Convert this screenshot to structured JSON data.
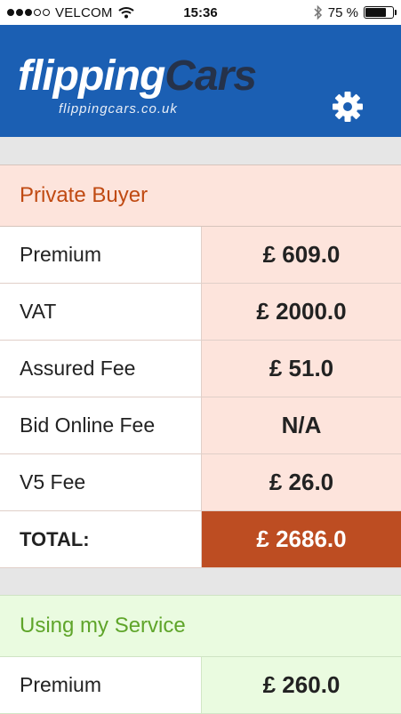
{
  "status_bar": {
    "carrier": "VELCOM",
    "time": "15:36",
    "battery_percent_label": "75 %",
    "battery_level": 0.75
  },
  "header": {
    "logo_part1": "flipping",
    "logo_part2": "Cars",
    "logo_sub": "flippingcars.co.uk",
    "settings_icon": "gear-icon"
  },
  "private_buyer": {
    "title": "Private Buyer",
    "rows": [
      {
        "label": "Premium",
        "value": "£ 609.0"
      },
      {
        "label": "VAT",
        "value": "£ 2000.0"
      },
      {
        "label": "Assured Fee",
        "value": "£ 51.0"
      },
      {
        "label": "Bid Online Fee",
        "value": "N/A"
      },
      {
        "label": "V5 Fee",
        "value": "£ 26.0"
      }
    ],
    "total_label": "TOTAL:",
    "total_value": "£ 2686.0"
  },
  "using_service": {
    "title": "Using my Service",
    "rows": [
      {
        "label": "Premium",
        "value": "£ 260.0"
      }
    ]
  },
  "colors": {
    "header_blue": "#1b5fb3",
    "private_accent": "#c04a12",
    "total_bg": "#bd4d22",
    "service_accent": "#5fa52a"
  }
}
